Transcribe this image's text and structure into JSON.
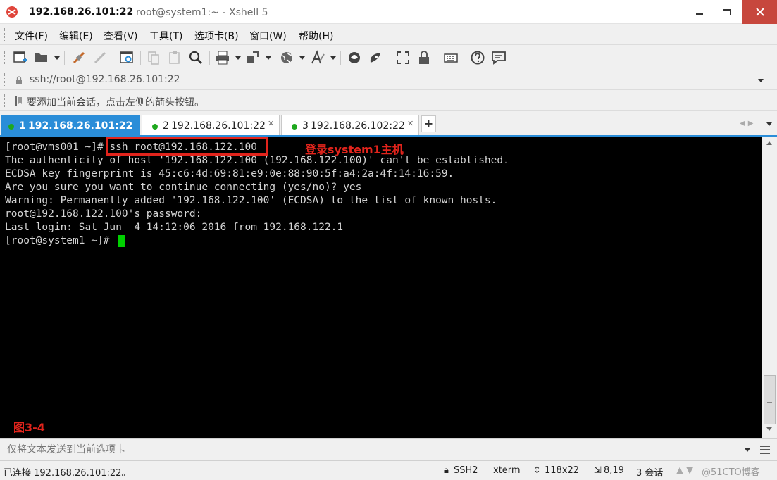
{
  "window": {
    "title_main": "192.168.26.101:22",
    "title_sub": "root@system1:~ - Xshell 5"
  },
  "menu": [
    "文件(F)",
    "编辑(E)",
    "查看(V)",
    "工具(T)",
    "选项卡(B)",
    "窗口(W)",
    "帮助(H)"
  ],
  "address": {
    "value": "ssh://root@192.168.26.101:22"
  },
  "hint": {
    "text": "要添加当前会话，点击左侧的箭头按钮。"
  },
  "tabs": [
    {
      "index": "1",
      "label": "192.168.26.101:22",
      "active": true
    },
    {
      "index": "2",
      "label": "192.168.26.101:22",
      "active": false
    },
    {
      "index": "3",
      "label": "192.168.26.102:22",
      "active": false
    }
  ],
  "terminal": {
    "lines": [
      "[root@vms001 ~]# ssh root@192.168.122.100",
      "The authenticity of host '192.168.122.100 (192.168.122.100)' can't be established.",
      "ECDSA key fingerprint is 45:c6:4d:69:81:e9:0e:88:90:5f:a4:2a:4f:14:16:59.",
      "Are you sure you want to continue connecting (yes/no)? yes",
      "Warning: Permanently added '192.168.122.100' (ECDSA) to the list of known hosts.",
      "root@192.168.122.100's password:",
      "Last login: Sat Jun  4 14:12:06 2016 from 192.168.122.1",
      "[root@system1 ~]# "
    ],
    "annotation": "登录system1主机",
    "figure_label": "图3-4"
  },
  "sendbar": {
    "placeholder": "仅将文本发送到当前选项卡"
  },
  "status": {
    "connection": "已连接 192.168.26.101:22。",
    "protocol": "SSH2",
    "terminal_type": "xterm",
    "size": "118x22",
    "cursor_pos": "8,19",
    "sessions": "3 会话",
    "watermark": "@51CTO博客"
  },
  "colors": {
    "accent": "#2a8dd8",
    "terminal_bg": "#000000",
    "terminal_fg": "#d4d4d4",
    "cursor": "#00d000",
    "annotation": "#e2241c",
    "close_button": "#c7473d"
  }
}
